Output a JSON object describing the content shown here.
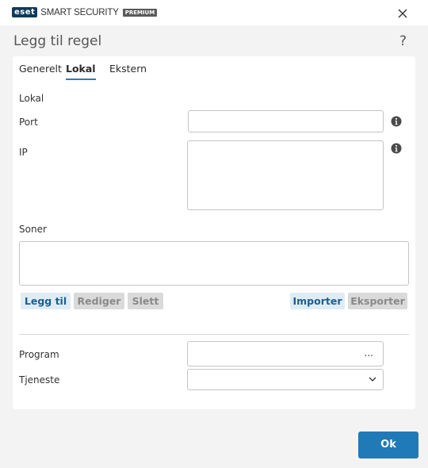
{
  "window": {
    "logo_brand": "eset",
    "logo_product": "SMART SECURITY",
    "logo_edition": "PREMIUM",
    "close_icon": "close-icon"
  },
  "dialog": {
    "title": "Legg til regel",
    "help_label": "?"
  },
  "tabs": [
    {
      "label": "Generelt",
      "active": false
    },
    {
      "label": "Lokal",
      "active": true
    },
    {
      "label": "Ekstern",
      "active": false
    }
  ],
  "form": {
    "section_title": "Lokal",
    "port_label": "Port",
    "port_value": "",
    "ip_label": "IP",
    "ip_value": "",
    "zones_label": "Soner",
    "zones_value": "",
    "program_label": "Program",
    "program_value": "",
    "program_browse": "...",
    "service_label": "Tjeneste",
    "service_value": ""
  },
  "zone_buttons": {
    "add": "Legg til",
    "edit": "Rediger",
    "delete": "Slett",
    "import": "Importer",
    "export": "Eksporter"
  },
  "footer": {
    "ok_label": "Ok"
  },
  "colors": {
    "accent": "#1f7ab7",
    "logo_bg": "#0d3a5c",
    "tab_underline": "#2a7db8",
    "enabled_button_bg": "#dfecf5",
    "disabled_button_bg": "#dadada"
  }
}
